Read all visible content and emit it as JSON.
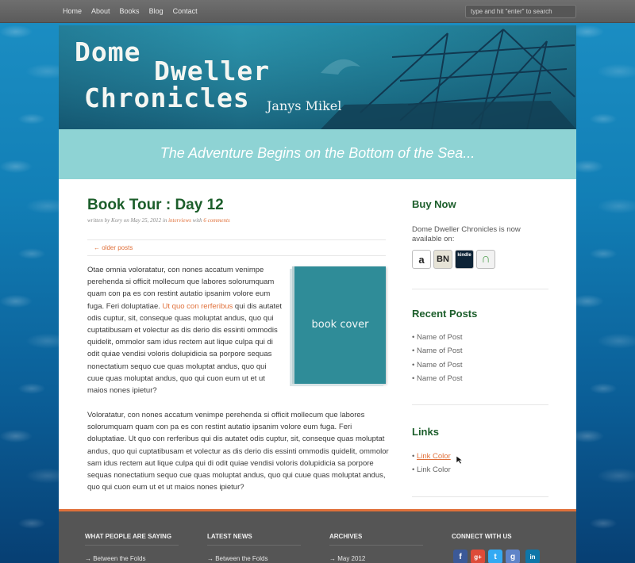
{
  "nav": [
    "Home",
    "About",
    "Books",
    "Blog",
    "Contact"
  ],
  "search": {
    "placeholder": "type and hit \"enter\" to search"
  },
  "banner": {
    "title_line1": "Dome",
    "title_line2": "Dweller",
    "title_line3": "Chronicles",
    "author": "Janys Mikel"
  },
  "tagline": "The Adventure Begins on the Bottom of the Sea...",
  "post": {
    "title": "Book Tour : Day 12",
    "meta_prefix": "written by Kory on May 25, 2012 in ",
    "meta_category": "interviews",
    "meta_with": " with ",
    "meta_comments": "6 comments",
    "older_posts": "← older posts",
    "para1_a": "Otae omnia voloratatur, con nones accatum venimpe perehenda si officit mollecum que labores solorumquam quam con pa es con restint autatio ipsanim volore eum fuga. Feri doluptatiae. ",
    "para1_link": "Ut quo con rerferibus",
    "para1_b": " qui dis autatet odis cuptur, sit, conseque quas moluptat andus, quo qui cuptatibusam et volectur as dis derio dis essinti ommodis quidelit, ommolor sam idus rectem aut lique culpa qui di odit quiae vendisi voloris dolupidicia sa porpore sequas nonectatium sequo cue quas moluptat andus, quo qui cuue quas moluptat andus, quo qui cuon eum  ut et ut maios nones ipietur?",
    "para2": "Voloratatur, con nones accatum venimpe perehenda si officit mollecum que labores solorumquam quam con pa es con restint autatio ipsanim volore eum fuga. Feri doluptatiae. Ut quo con rerferibus qui dis autatet odis cuptur, sit, conseque quas moluptat andus, quo qui cuptatibusam et volectur as dis derio dis essinti ommodis quidelit, ommolor sam idus rectem aut lique culpa qui di odit quiae vendisi voloris dolupidicia sa porpore sequas nonectatium sequo cue quas moluptat andus, quo qui cuue quas moluptat andus, quo qui cuon eum  ut et ut maios nones ipietur?",
    "cover_label": "book cover"
  },
  "sidebar": {
    "buy_heading": "Buy Now",
    "buy_text": "Dome Dweller Chronicles is now available on:",
    "stores": [
      {
        "label": "a",
        "icon": "amazon-icon"
      },
      {
        "label": "BN",
        "icon": "barnes-noble-icon"
      },
      {
        "label": "kindle",
        "icon": "kindle-icon"
      },
      {
        "label": "∩",
        "icon": "nook-icon"
      }
    ],
    "recent_heading": "Recent Posts",
    "recent_posts": [
      "• Name of Post",
      "• Name of Post",
      "• Name of Post",
      "• Name of Post"
    ],
    "links_heading": "Links",
    "link1_bullet": "• ",
    "link1": "Link Color",
    "link2": "• Link Color"
  },
  "footer": {
    "col1": "WHAT PEOPLE ARE SAYING",
    "col2": "LATEST NEWS",
    "col3": "ARCHIVES",
    "col4": "CONNECT WITH US",
    "col1_item": "→ Between the Folds",
    "col2_item": "→ Between the Folds",
    "col3_item": "→ May 2012",
    "social": [
      "f",
      "g+",
      "t",
      "g",
      "in"
    ]
  },
  "colors": {
    "accent": "#e0703a",
    "heading_green": "#1c5e2b",
    "tagline_band": "#8ed3d4",
    "footer": "#555555"
  }
}
